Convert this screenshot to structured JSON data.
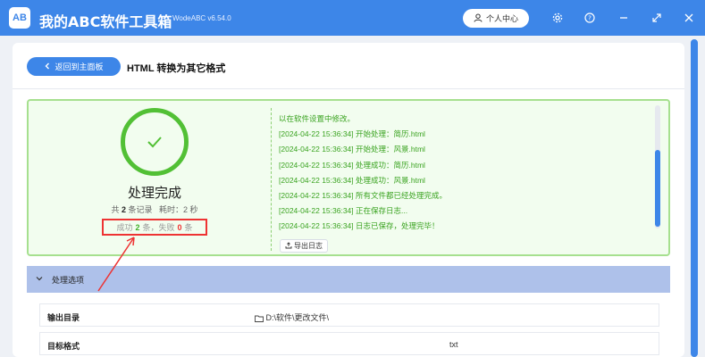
{
  "app": {
    "logo_text": "AB",
    "title": "我的ABC软件工具箱",
    "version": "WodeABC v6.54.0",
    "user_center": "个人中心"
  },
  "header": {
    "back_label": "返回到主面板",
    "page_title": "HTML 转换为其它格式"
  },
  "result": {
    "status": "处理完成",
    "summary_prefix": "共",
    "record_count": "2",
    "record_suffix": "条记录",
    "time_label": "耗时：",
    "time_value": "2 秒",
    "success_label": "成功",
    "success_count": "2",
    "success_unit": "条，失败",
    "fail_count": "0",
    "fail_unit": "条",
    "export_label": "导出日志",
    "log": [
      "以在软件设置中修改。",
      "[2024-04-22 15:36:34] 开始处理：简历.html",
      "[2024-04-22 15:36:34] 开始处理：风景.html",
      "[2024-04-22 15:36:34] 处理成功：简历.html",
      "[2024-04-22 15:36:34] 处理成功：风景.html",
      "[2024-04-22 15:36:34] 所有文件都已经处理完成。",
      "[2024-04-22 15:36:34] 正在保存日志...",
      "[2024-04-22 15:36:34] 日志已保存，处理完毕！"
    ]
  },
  "options": {
    "header": "处理选项",
    "output_dir_label": "输出目录",
    "output_dir_value": "D:\\软件\\更改文件\\",
    "target_format_label": "目标格式",
    "target_format_value": "txt"
  },
  "colors": {
    "accent": "#3d86e8",
    "success": "#52c035",
    "error": "#e33333"
  }
}
